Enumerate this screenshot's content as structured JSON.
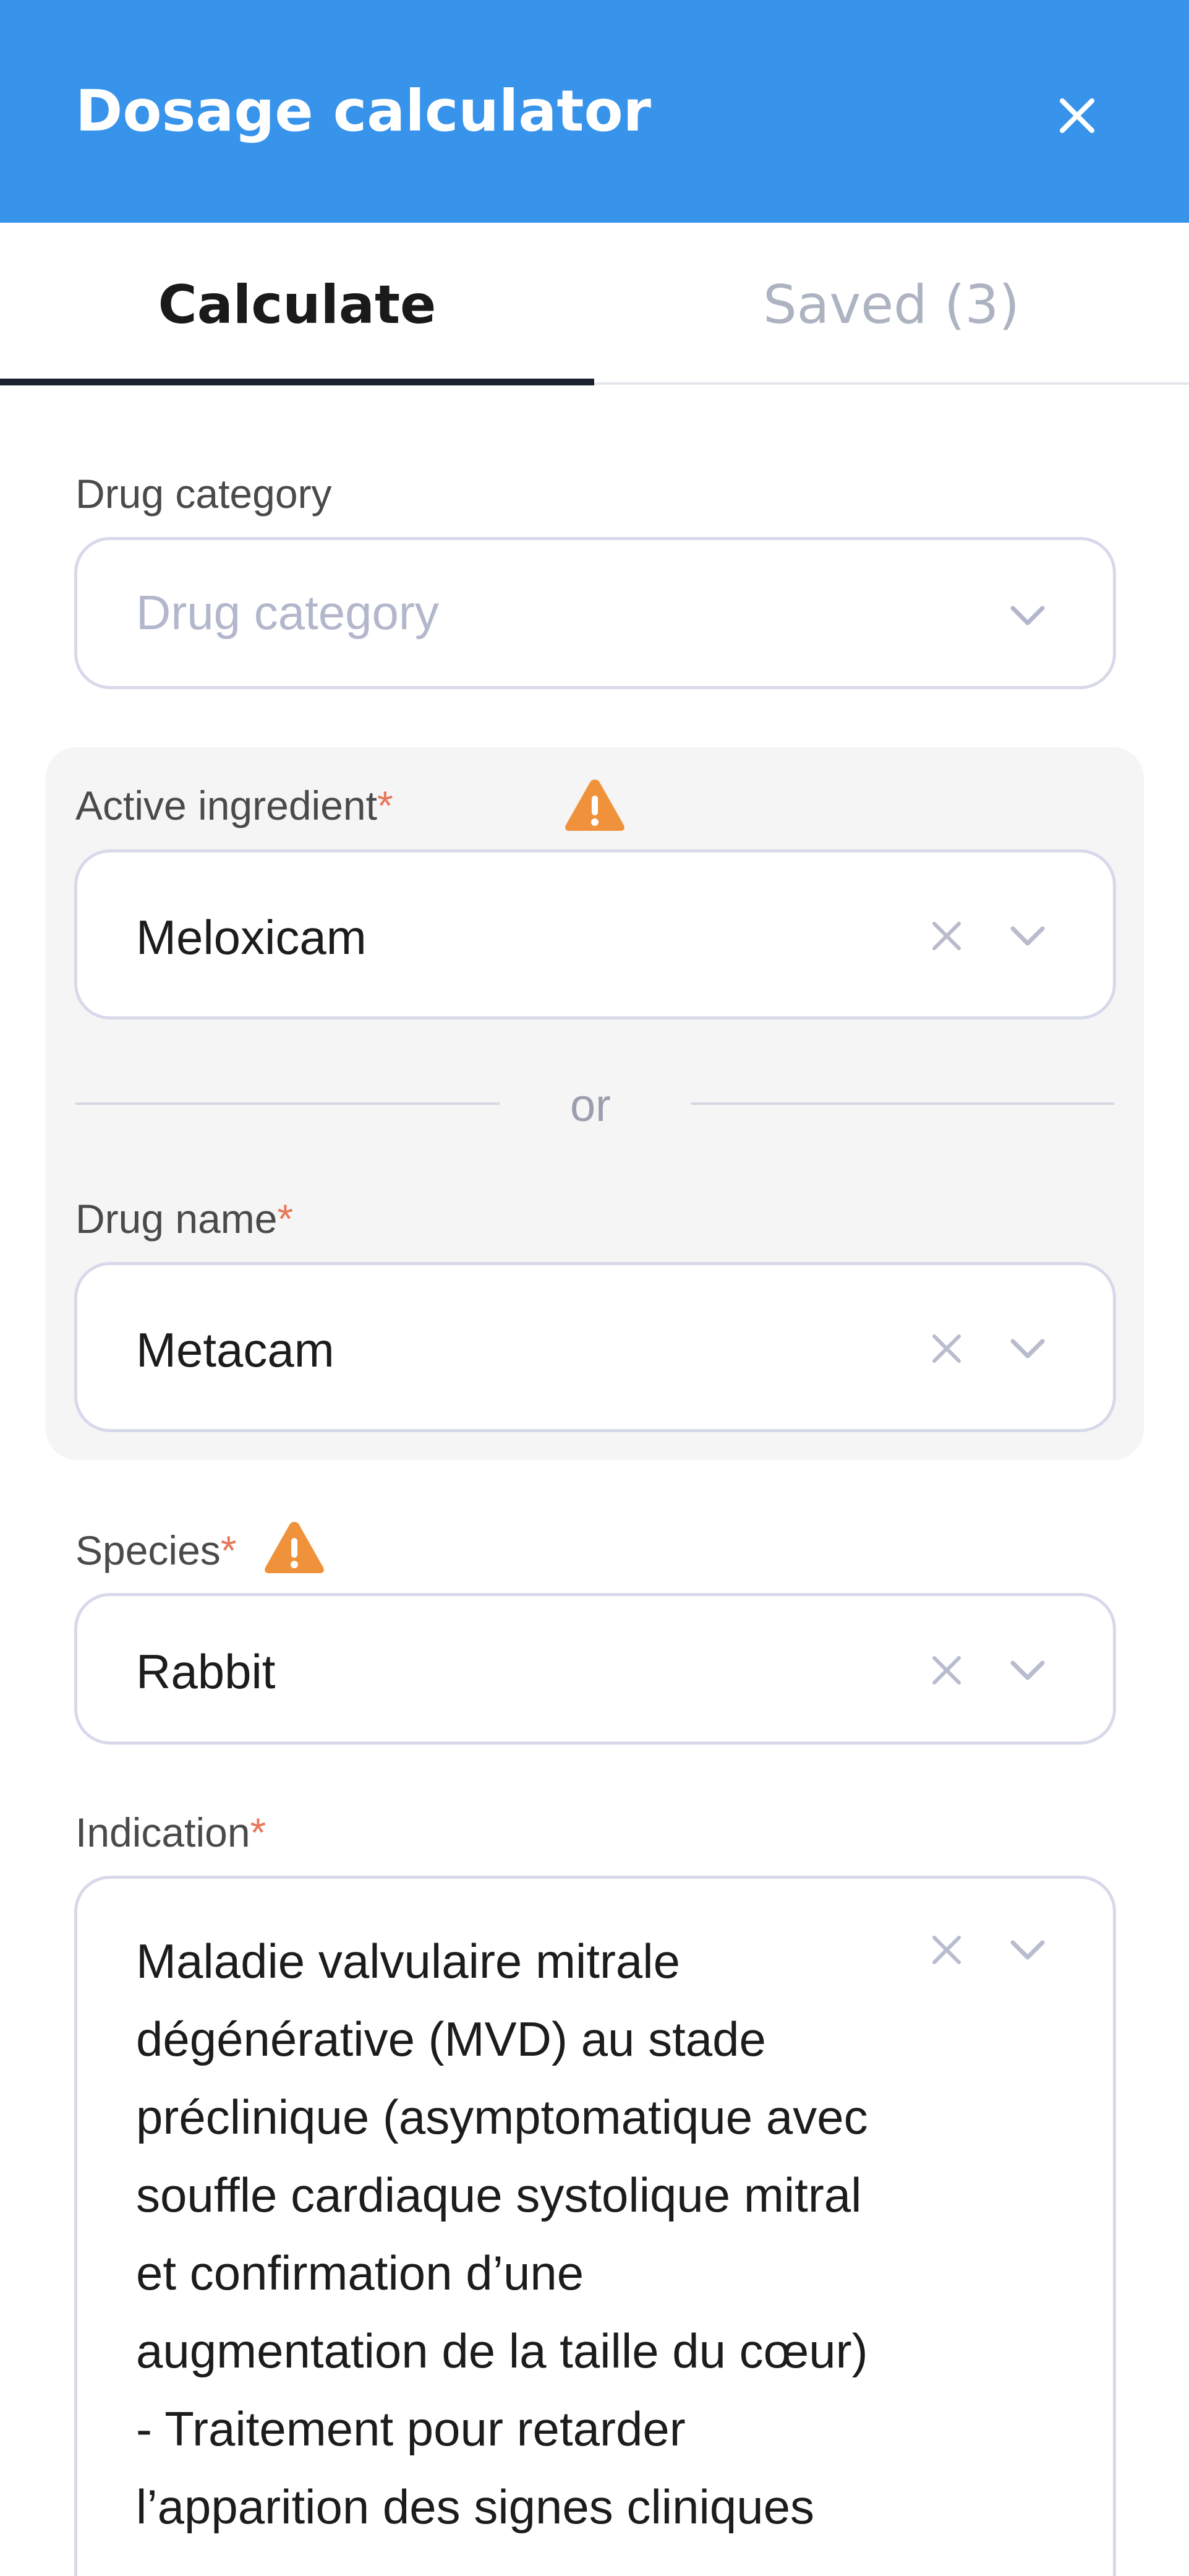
{
  "header": {
    "title": "Dosage calculator",
    "close_icon": "close-icon",
    "background_color": "#3893ea"
  },
  "tabs": [
    {
      "label": "Calculate",
      "active": true
    },
    {
      "label": "Saved (3)",
      "active": false
    }
  ],
  "form": {
    "drug_category": {
      "label": "Drug category",
      "placeholder": "Drug category",
      "value": ""
    },
    "active_ingredient": {
      "label": "Active ingredient",
      "required_mark": "*",
      "value": "Meloxicam",
      "warning_icon": "warning-icon"
    },
    "separator": {
      "label": "or"
    },
    "drug_name": {
      "label": "Drug name",
      "required_mark": "*",
      "value": "Metacam"
    },
    "species": {
      "label": "Species",
      "required_mark": "*",
      "value": "Rabbit",
      "warning_icon": "warning-icon"
    },
    "indication": {
      "label": "Indication",
      "required_mark": "*",
      "value": "Maladie valvulaire mitrale\ndégénérative (MVD) au stade\npréclinique (asymptomatique avec\nsouffle cardiaque systolique mitral\net confirmation d’une\naugmentation de la taille du cœur)\n- Traitement pour retarder\nl’apparition des signes cliniques"
    }
  },
  "colors": {
    "accent": "#3893ea",
    "required": "#e8775a",
    "warning": "#f0913b",
    "border": "#d7d9ea",
    "tab_active_underline": "#1a2230"
  }
}
